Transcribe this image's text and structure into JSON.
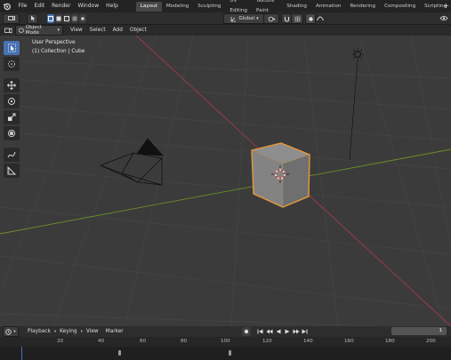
{
  "menu": {
    "items": [
      "File",
      "Edit",
      "Render",
      "Window",
      "Help"
    ]
  },
  "workspaces": {
    "tabs": [
      "Layout",
      "Modeling",
      "Sculpting",
      "UV Editing",
      "Texture Paint",
      "Shading",
      "Animation",
      "Rendering",
      "Compositing",
      "Scripting"
    ],
    "active": "Layout"
  },
  "header": {
    "mode": "Object Mode",
    "menus": [
      "View",
      "Select",
      "Add",
      "Object"
    ],
    "orientation": "Global"
  },
  "viewport": {
    "perspective": "User Perspective",
    "collection_info": "(1) Collection | Cube"
  },
  "timeline": {
    "menus": [
      "Playback",
      "Keying",
      "View",
      "Marker"
    ],
    "frame_value": "1",
    "current_frame": "1",
    "ticks": [
      "20",
      "40",
      "60",
      "80",
      "100",
      "120",
      "140",
      "160",
      "180",
      "200"
    ]
  },
  "colors": {
    "accent": "#4772b3",
    "selection": "#e59a39",
    "x_axis": "#a33a45",
    "y_axis": "#6c8f25"
  }
}
